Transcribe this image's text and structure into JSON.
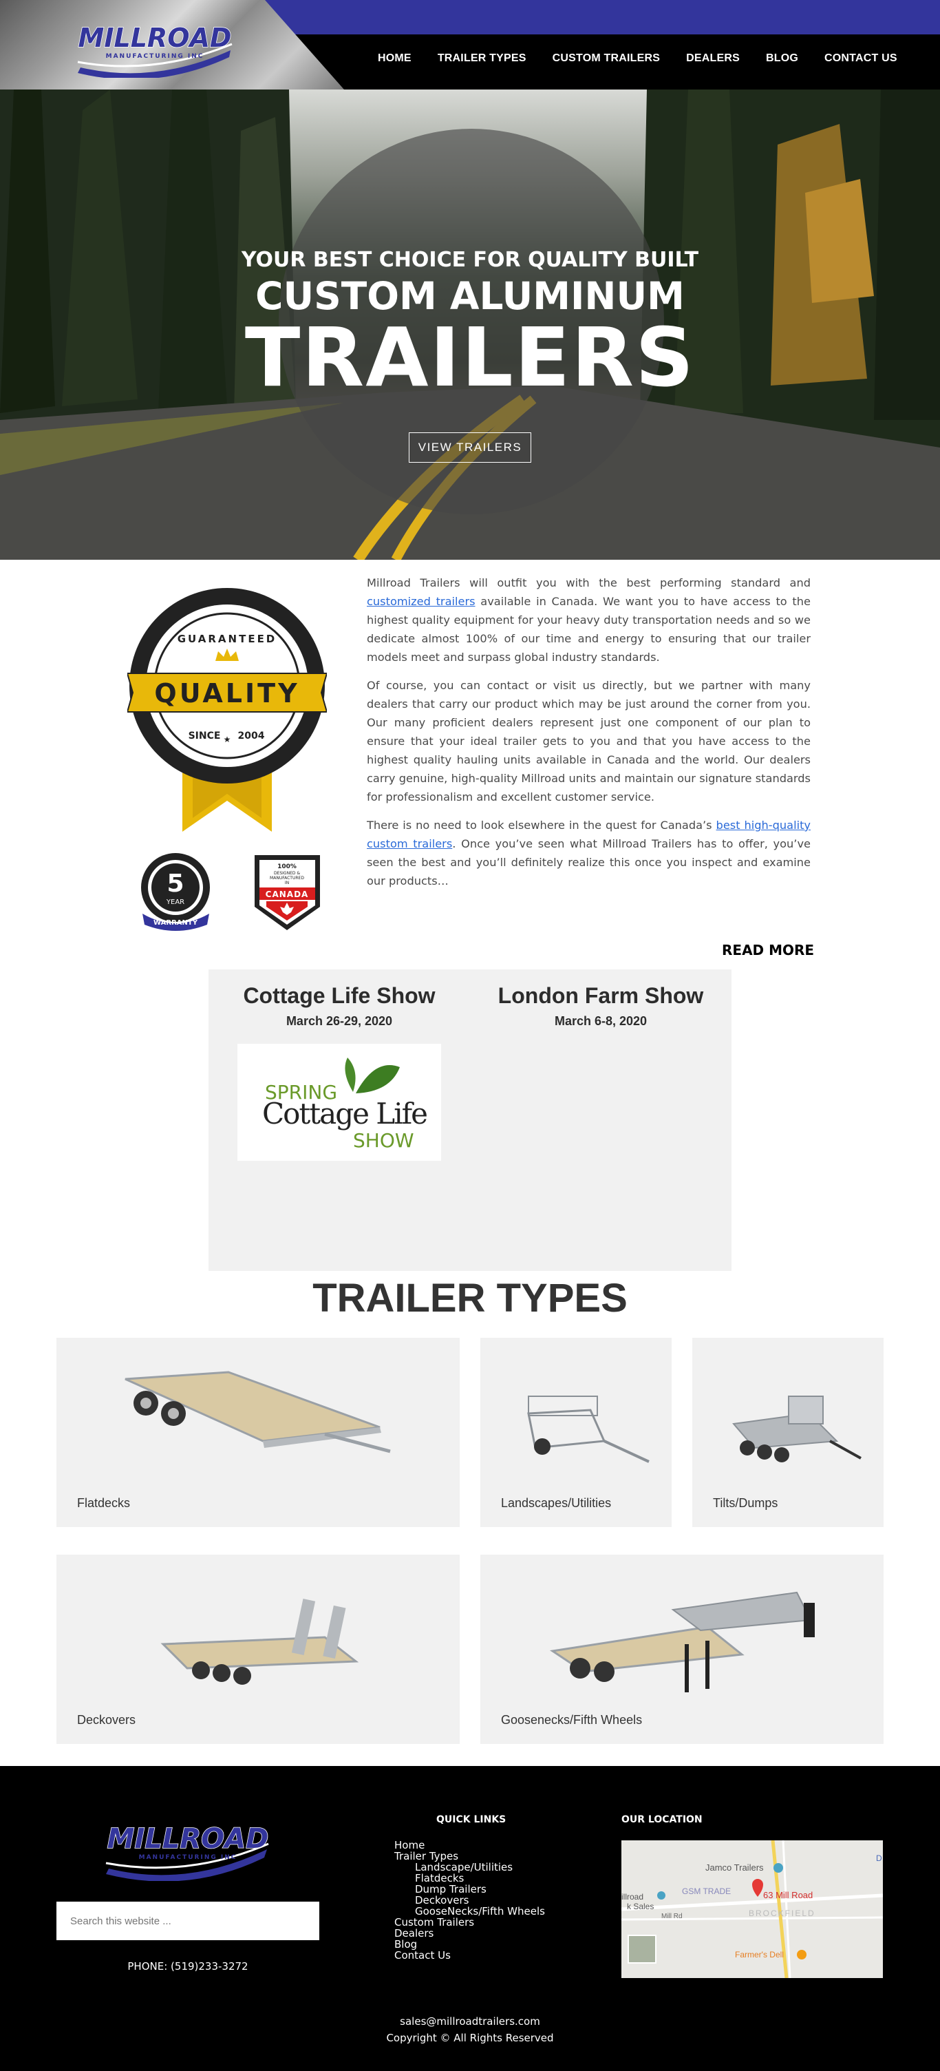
{
  "header": {
    "logo_text": "MILLROAD",
    "logo_subtext": "MANUFACTURING INC",
    "nav": [
      "HOME",
      "TRAILER TYPES",
      "CUSTOM TRAILERS",
      "DEALERS",
      "BLOG",
      "CONTACT US"
    ]
  },
  "hero": {
    "pre": "YOUR BEST CHOICE FOR QUALITY BUILT",
    "mid": "CUSTOM ALUMINUM",
    "big": "TRAILERS",
    "button": "VIEW TRAILERS"
  },
  "badges": {
    "quality_top": "GUARANTEED",
    "quality": "QUALITY",
    "quality_since": "SINCE",
    "quality_year": "2004",
    "warranty_num": "5",
    "warranty_year": "YEAR",
    "warranty_label": "WARRANTY",
    "canada_top": "100%",
    "canada_mid": "DESIGNED &",
    "canada_mid2": "MANUFACTURED",
    "canada_in": "IN",
    "canada_label": "CANADA"
  },
  "intro": {
    "p1_a": "Millroad Trailers will outfit you with the best performing standard and ",
    "p1_link": "customized trailers",
    "p1_b": " available in Canada. We want you to have access to the highest quality equipment for your heavy duty transportation needs and so we dedicate almost 100% of our time and energy to ensuring that our trailer models meet and surpass global industry standards.",
    "p2": "Of course, you can contact or visit us directly, but we partner with many dealers that carry our product which may be just around the corner from you. Our many proficient dealers represent just one component of our plan to ensure that your ideal trailer gets to you and that you have access to the highest quality hauling units available in Canada and the world. Our dealers carry genuine, high-quality Millroad units and maintain our signature standards for professionalism and excellent customer service.",
    "p3_a": "There is no need to look elsewhere in the quest for Canada’s ",
    "p3_link": "best high-quality custom trailers",
    "p3_b": ". Once you’ve seen what Millroad Trailers has to offer, you’ve seen the best and you’ll definitely realize this once you inspect and examine our products…",
    "read_more": "READ MORE"
  },
  "shows": [
    {
      "title": "Cottage Life Show",
      "date": "March 26-29, 2020"
    },
    {
      "title": "London Farm Show",
      "date": "March 6-8, 2020"
    }
  ],
  "show_logo": {
    "line1": "SPRING",
    "line2": "Cottage Life",
    "line3": "SHOW"
  },
  "trailer_types": {
    "title": "TRAILER TYPES",
    "items": [
      "Flatdecks",
      "Landscapes/Utilities",
      "Tilts/Dumps",
      "Deckovers",
      "Goosenecks/Fifth Wheels"
    ]
  },
  "footer": {
    "search_placeholder": "Search this website ...",
    "phone": "PHONE: (519)233-3272",
    "quick_links_title": "QUICK LINKS",
    "links": {
      "home": "Home",
      "trailer_types": "Trailer Types",
      "landscape": "Landscape/Utilities",
      "flatdecks": "Flatdecks",
      "dump": "Dump Trailers",
      "deckovers": "Deckovers",
      "goosenecks": "GooseNecks/Fifth Wheels",
      "custom": "Custom Trailers",
      "dealers": "Dealers",
      "blog": "Blog",
      "contact": "Contact Us"
    },
    "location_title": "OUR LOCATION",
    "map": {
      "place1": "Jamco Trailers",
      "place2": "63 Mill Road",
      "place3": "GSM TRADE",
      "place4": "illroad",
      "place5": "k Sales",
      "place6": "Mill Rd",
      "place7": "BROCKFIELD",
      "place8": "Farmer's Dell",
      "place9": "D"
    },
    "email": "sales@millroadtrailers.com",
    "copyright": "Copyright © All Rights Reserved"
  },
  "colors": {
    "brand_blue": "#33359c",
    "accent_gold": "#e8b80a",
    "link": "#2a6ad8"
  }
}
